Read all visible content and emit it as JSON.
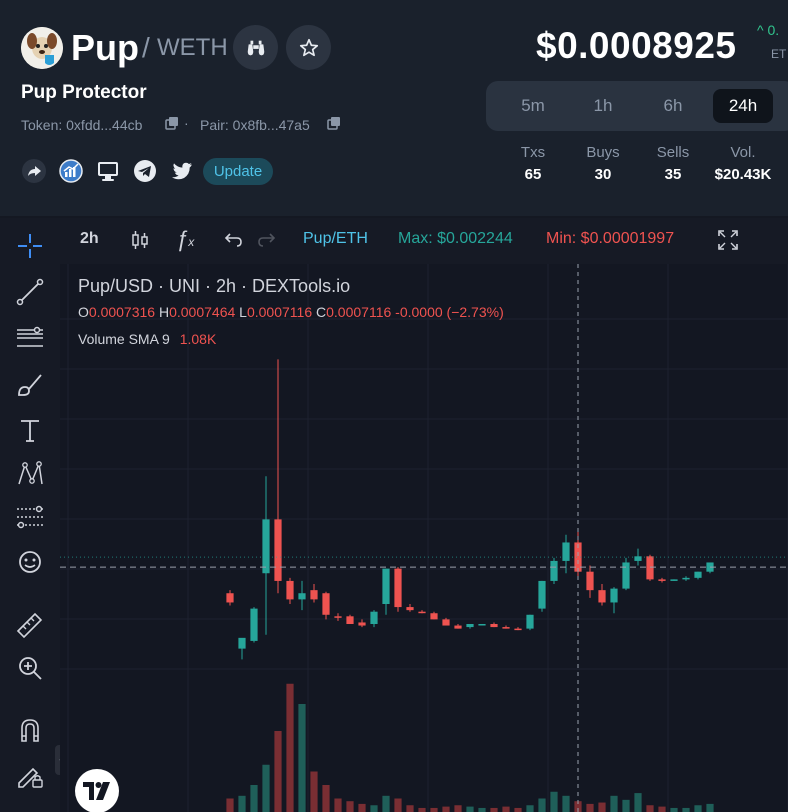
{
  "header": {
    "base_symbol": "Pup",
    "slash": "/",
    "quote_symbol": "WETH",
    "token_name": "Pup Protector",
    "token_addr": "Token: 0xfdd...44cb",
    "pair_addr": "Pair: 0x8fb...47a5",
    "separator": "·",
    "update_label": "Update",
    "price": "$0.0008925",
    "change": "^ 0.",
    "change_sub": "ET"
  },
  "timeframes": [
    "5m",
    "1h",
    "6h",
    "24h"
  ],
  "active_timeframe": "24h",
  "stats": {
    "txs_label": "Txs",
    "txs": "65",
    "buys_label": "Buys",
    "buys": "30",
    "sells_label": "Sells",
    "sells": "35",
    "vol_label": "Vol.",
    "vol": "$20.43K"
  },
  "chart_toolbar": {
    "interval": "2h",
    "pair": "Pup/ETH",
    "max_label": "Max: $0.002244",
    "min_label": "Min: $0.00001997"
  },
  "legend": {
    "symbol": "Pup/USD · UNI · 2h · DEXTools.io",
    "o_label": "O",
    "o": "0.0007316",
    "h_label": "H",
    "h": "0.0007464",
    "l_label": "L",
    "l": "0.0007116",
    "c_label": "C",
    "c": "0.0007116",
    "change": "-0.0000 (−2.73%)",
    "volume_label": "Volume SMA 9",
    "volume": "1.08K"
  },
  "colors": {
    "up": "#26a69a",
    "down": "#ef5350",
    "accent": "#4fc3e8",
    "background": "#131722",
    "header": "#1a212c"
  },
  "icons": {
    "logo": "pup-logo",
    "hdr_btn_1": "binoculars-icon",
    "hdr_btn_2": "star-icon",
    "socials": [
      "share-icon",
      "chart-circle-icon",
      "monitor-icon",
      "telegram-icon",
      "twitter-icon"
    ],
    "tools": [
      "crosshair-icon",
      "trend-line-icon",
      "fib-lines-icon",
      "brush-icon",
      "text-icon",
      "pattern-icon",
      "forecast-icon",
      "emoji-icon",
      "ruler-icon",
      "zoom-in-icon",
      "magnet-icon",
      "lock-pencil-icon"
    ]
  },
  "chart_data": {
    "type": "candlestick",
    "candles": [
      {
        "o": 0.00072,
        "h": 0.00074,
        "l": 0.00064,
        "c": 0.00066,
        "dir": "down"
      },
      {
        "o": 0.00036,
        "h": 0.0004,
        "l": 0.00029,
        "c": 0.00043,
        "dir": "up"
      },
      {
        "o": 0.00041,
        "h": 0.00063,
        "l": 0.0004,
        "c": 0.00062,
        "dir": "up"
      },
      {
        "o": 0.00085,
        "h": 0.00148,
        "l": 0.00045,
        "c": 0.0012,
        "dir": "up"
      },
      {
        "o": 0.0012,
        "h": 0.00224,
        "l": 0.00072,
        "c": 0.0008,
        "dir": "down"
      },
      {
        "o": 0.0008,
        "h": 0.00082,
        "l": 0.00065,
        "c": 0.00068,
        "dir": "down"
      },
      {
        "o": 0.00068,
        "h": 0.0008,
        "l": 0.00061,
        "c": 0.00072,
        "dir": "up"
      },
      {
        "o": 0.00074,
        "h": 0.00078,
        "l": 0.00066,
        "c": 0.00068,
        "dir": "down"
      },
      {
        "o": 0.00072,
        "h": 0.00073,
        "l": 0.00055,
        "c": 0.00058,
        "dir": "down"
      },
      {
        "o": 0.00057,
        "h": 0.00059,
        "l": 0.00054,
        "c": 0.00057,
        "dir": "down"
      },
      {
        "o": 0.00057,
        "h": 0.00058,
        "l": 0.00052,
        "c": 0.00052,
        "dir": "down"
      },
      {
        "o": 0.00053,
        "h": 0.00055,
        "l": 0.0005,
        "c": 0.00051,
        "dir": "down"
      },
      {
        "o": 0.00052,
        "h": 0.00061,
        "l": 0.0005,
        "c": 0.0006,
        "dir": "up"
      },
      {
        "o": 0.00065,
        "h": 0.00088,
        "l": 0.00058,
        "c": 0.00088,
        "dir": "up"
      },
      {
        "o": 0.00088,
        "h": 0.00089,
        "l": 0.0006,
        "c": 0.00063,
        "dir": "down"
      },
      {
        "o": 0.00063,
        "h": 0.00065,
        "l": 0.0006,
        "c": 0.00061,
        "dir": "down"
      },
      {
        "o": 0.0006,
        "h": 0.00061,
        "l": 0.00059,
        "c": 0.0006,
        "dir": "down"
      },
      {
        "o": 0.00059,
        "h": 0.0006,
        "l": 0.00055,
        "c": 0.00055,
        "dir": "down"
      },
      {
        "o": 0.00055,
        "h": 0.00056,
        "l": 0.00051,
        "c": 0.00051,
        "dir": "down"
      },
      {
        "o": 0.00051,
        "h": 0.00052,
        "l": 0.00049,
        "c": 0.00049,
        "dir": "down"
      },
      {
        "o": 0.0005,
        "h": 0.00052,
        "l": 0.00049,
        "c": 0.00052,
        "dir": "up"
      },
      {
        "o": 0.00052,
        "h": 0.00052,
        "l": 0.00052,
        "c": 0.00052,
        "dir": "up"
      },
      {
        "o": 0.00052,
        "h": 0.00053,
        "l": 0.0005,
        "c": 0.0005,
        "dir": "down"
      },
      {
        "o": 0.0005,
        "h": 0.00051,
        "l": 0.00049,
        "c": 0.00049,
        "dir": "down"
      },
      {
        "o": 0.00049,
        "h": 0.0005,
        "l": 0.00048,
        "c": 0.00049,
        "dir": "down"
      },
      {
        "o": 0.00049,
        "h": 0.00058,
        "l": 0.00048,
        "c": 0.00058,
        "dir": "up"
      },
      {
        "o": 0.00062,
        "h": 0.0008,
        "l": 0.0006,
        "c": 0.0008,
        "dir": "up"
      },
      {
        "o": 0.0008,
        "h": 0.00095,
        "l": 0.00078,
        "c": 0.00093,
        "dir": "up"
      },
      {
        "o": 0.00093,
        "h": 0.0011,
        "l": 0.00085,
        "c": 0.00105,
        "dir": "up"
      },
      {
        "o": 0.00105,
        "h": 0.00112,
        "l": 0.00083,
        "c": 0.00086,
        "dir": "down"
      },
      {
        "o": 0.00086,
        "h": 0.0009,
        "l": 0.00069,
        "c": 0.00074,
        "dir": "down"
      },
      {
        "o": 0.00074,
        "h": 0.00078,
        "l": 0.00064,
        "c": 0.00066,
        "dir": "down"
      },
      {
        "o": 0.00066,
        "h": 0.00076,
        "l": 0.00059,
        "c": 0.00075,
        "dir": "up"
      },
      {
        "o": 0.00075,
        "h": 0.00095,
        "l": 0.00074,
        "c": 0.00092,
        "dir": "up"
      },
      {
        "o": 0.00093,
        "h": 0.00101,
        "l": 0.0009,
        "c": 0.00096,
        "dir": "up"
      },
      {
        "o": 0.00096,
        "h": 0.00097,
        "l": 0.0008,
        "c": 0.00081,
        "dir": "down"
      },
      {
        "o": 0.00081,
        "h": 0.00082,
        "l": 0.00079,
        "c": 0.0008,
        "dir": "down"
      },
      {
        "o": 0.0008,
        "h": 0.00081,
        "l": 0.0008,
        "c": 0.00081,
        "dir": "up"
      },
      {
        "o": 0.00081,
        "h": 0.00083,
        "l": 0.0008,
        "c": 0.00082,
        "dir": "up"
      },
      {
        "o": 0.00082,
        "h": 0.00086,
        "l": 0.00081,
        "c": 0.00086,
        "dir": "up"
      },
      {
        "o": 0.00086,
        "h": 0.00092,
        "l": 0.00085,
        "c": 0.00092,
        "dir": "up"
      }
    ],
    "volumes": [
      0.1,
      0.12,
      0.2,
      0.35,
      0.6,
      0.95,
      0.8,
      0.3,
      0.2,
      0.1,
      0.08,
      0.06,
      0.05,
      0.12,
      0.1,
      0.05,
      0.03,
      0.03,
      0.04,
      0.05,
      0.04,
      0.03,
      0.03,
      0.04,
      0.03,
      0.05,
      0.1,
      0.15,
      0.12,
      0.08,
      0.06,
      0.07,
      0.12,
      0.09,
      0.14,
      0.05,
      0.04,
      0.03,
      0.03,
      0.05,
      0.06
    ],
    "current_price": 0.00089,
    "ylim": [
      0.0,
      0.0026
    ]
  }
}
